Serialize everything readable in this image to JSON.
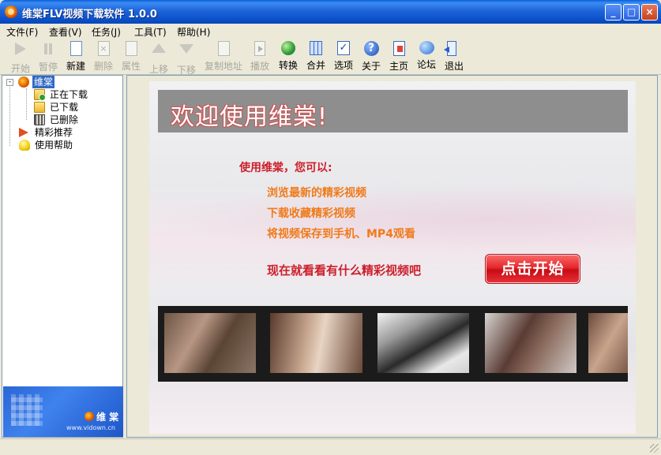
{
  "window": {
    "title": "维棠FLV视频下载软件 1.0.0",
    "min_glyph": "_",
    "max_glyph": "□",
    "close_glyph": "×"
  },
  "menu": [
    "文件(F)",
    "查看(V)",
    "任务(J)",
    "工具(T)",
    "帮助(H)"
  ],
  "toolbar": [
    {
      "label": "开始",
      "icon": "play-arrow-icon",
      "enabled": false
    },
    {
      "label": "暂停",
      "icon": "pause-icon",
      "enabled": false
    },
    {
      "label": "新建",
      "icon": "new-document-icon",
      "enabled": true
    },
    {
      "label": "删除",
      "icon": "delete-document-icon",
      "enabled": false
    },
    {
      "label": "属性",
      "icon": "properties-icon",
      "enabled": false
    },
    {
      "label": "上移",
      "icon": "move-up-icon",
      "enabled": false
    },
    {
      "label": "下移",
      "icon": "move-down-icon",
      "enabled": false
    },
    {
      "label": "复制地址",
      "icon": "copy-address-icon",
      "enabled": false
    },
    {
      "label": "播放",
      "icon": "play-file-icon",
      "enabled": false
    },
    {
      "label": "转换",
      "icon": "convert-globe-icon",
      "enabled": true
    },
    {
      "label": "合并",
      "icon": "merge-grid-icon",
      "enabled": true
    },
    {
      "label": "选项",
      "icon": "options-check-icon",
      "enabled": true
    },
    {
      "label": "关于",
      "icon": "about-help-icon",
      "enabled": true
    },
    {
      "label": "主页",
      "icon": "homepage-icon",
      "enabled": true
    },
    {
      "label": "论坛",
      "icon": "forum-chat-icon",
      "enabled": true
    },
    {
      "label": "退出",
      "icon": "exit-door-icon",
      "enabled": true
    }
  ],
  "tree": {
    "toggle": "-",
    "root": "维棠",
    "children": [
      "正在下载",
      "已下载",
      "已删除"
    ],
    "others": [
      "精彩推荐",
      "使用帮助"
    ]
  },
  "brand": {
    "name": "维 棠",
    "url": "www.vidown.cn"
  },
  "welcome": {
    "banner": "欢迎使用维棠!",
    "intro": "使用维棠，您可以:",
    "features": [
      "浏览最新的精彩视频",
      "下载收藏精彩视频",
      "将视频保存到手机、MP4观看"
    ],
    "cta": "现在就看看有什么精彩视频吧",
    "start_button": "点击开始"
  },
  "colors": {
    "title_bar": "#0a4fc7",
    "banner_bg": "#8e8e8e",
    "intro_text": "#cc1f2a",
    "feature_text": "#f07a1a",
    "start_button": "#e5282c"
  }
}
